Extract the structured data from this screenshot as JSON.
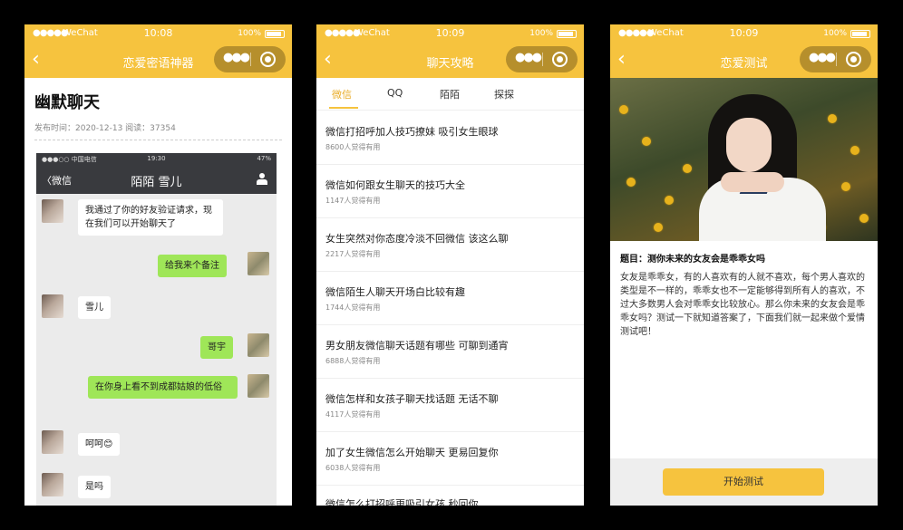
{
  "colors": {
    "accent": "#f6c33e",
    "chat_out": "#9fe658",
    "tab_active": "#e9ad2a"
  },
  "status": {
    "carrier": "WeChat",
    "battery": "100%"
  },
  "phone1": {
    "time": "10:08",
    "nav_title": "恋爱密语神器",
    "article_title": "幽默聊天",
    "meta": "发布时间：2020-12-13 阅读：37354",
    "shot": {
      "status_left": "●●●○○ 中国电信 ",
      "status_time": "19:30",
      "status_right": "47%",
      "back_label": "〈微信",
      "title": "陌陌 雪儿",
      "messages": [
        {
          "side": "in",
          "text": "我通过了你的好友验证请求，现在我们可以开始聊天了"
        },
        {
          "side": "out",
          "text": "给我来个备注"
        },
        {
          "side": "in",
          "text": "雪儿"
        },
        {
          "side": "out",
          "text": "哥宇"
        },
        {
          "side": "out",
          "text": "在你身上看不到成都姑娘的低俗"
        },
        {
          "side": "in",
          "text": "呵呵😊"
        },
        {
          "side": "in",
          "text": "是吗"
        }
      ]
    }
  },
  "phone2": {
    "time": "10:09",
    "nav_title": "聊天攻略",
    "tabs": [
      "微信",
      "QQ",
      "陌陌",
      "探探"
    ],
    "items": [
      {
        "title": "微信打招呼加人技巧撩妹 吸引女生眼球",
        "sub": "8600人觉得有用"
      },
      {
        "title": "微信如何跟女生聊天的技巧大全",
        "sub": "1147人觉得有用"
      },
      {
        "title": "女生突然对你态度冷淡不回微信 该这么聊",
        "sub": "2217人觉得有用"
      },
      {
        "title": "微信陌生人聊天开场白比较有趣",
        "sub": "1744人觉得有用"
      },
      {
        "title": "男女朋友微信聊天话题有哪些 可聊到通宵",
        "sub": "6888人觉得有用"
      },
      {
        "title": "微信怎样和女孩子聊天找话题 无话不聊",
        "sub": "4117人觉得有用"
      },
      {
        "title": "加了女生微信怎么开始聊天 更易回复你",
        "sub": "6038人觉得有用"
      },
      {
        "title": "微信怎么打招呼更吸引女孩 秒回你",
        "sub": ""
      }
    ]
  },
  "phone3": {
    "time": "10:09",
    "nav_title": "恋爱测试",
    "question_title": "题目：测你未来的女友会是乖乖女吗",
    "question_body": "女友是乖乖女，有的人喜欢有的人就不喜欢，每个男人喜欢的类型是不一样的，乖乖女也不一定能够得到所有人的喜欢，不过大多数男人会对乖乖女比较放心。那么你未来的女友会是乖乖女吗？测试一下就知道答案了，下面我们就一起来做个爱情测试吧！",
    "start_button": "开始测试"
  }
}
